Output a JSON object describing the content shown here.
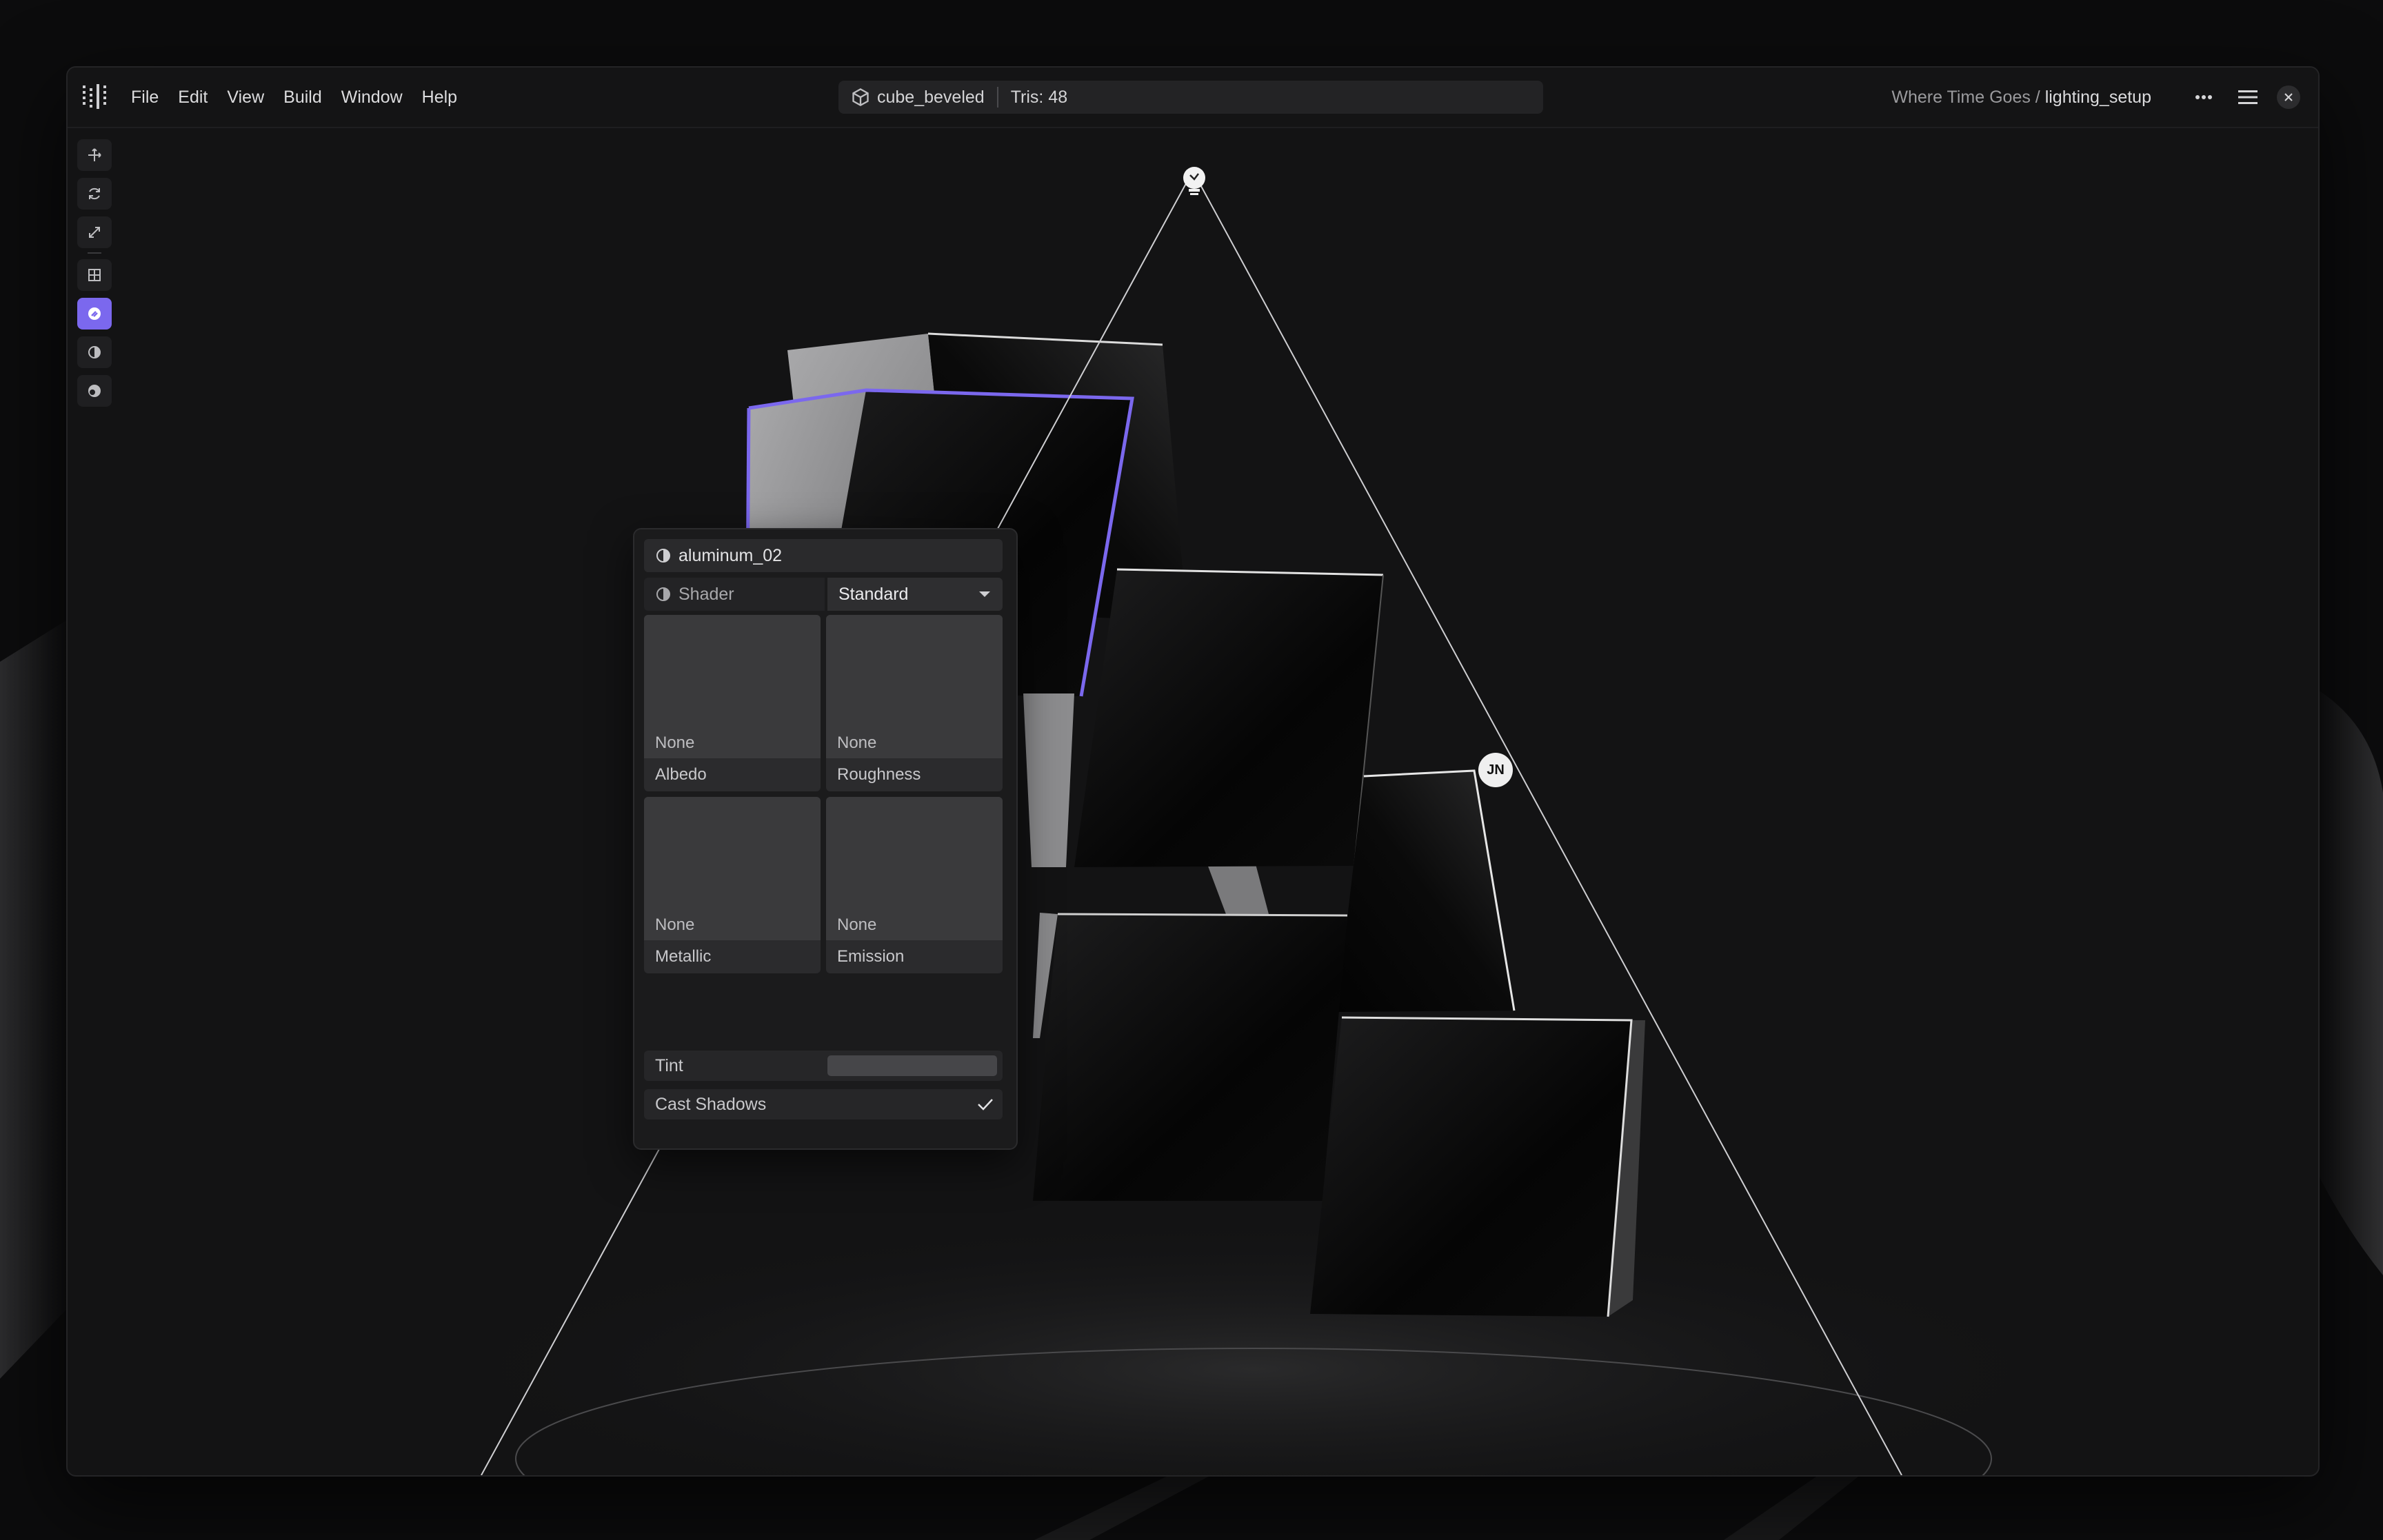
{
  "menu": {
    "items": [
      {
        "label": "File"
      },
      {
        "label": "Edit"
      },
      {
        "label": "View"
      },
      {
        "label": "Build"
      },
      {
        "label": "Window"
      },
      {
        "label": "Help"
      }
    ]
  },
  "object_field": {
    "icon": "cube-icon",
    "name": "cube_beveled",
    "tris": "Tris: 48"
  },
  "breadcrumb": {
    "project": "Where Time Goes / ",
    "scene": "lighting_setup"
  },
  "toolbar": {
    "tools": [
      "move-icon",
      "rotate-icon",
      "scale-icon",
      "grid-icon",
      "paint-icon",
      "material-icon",
      "shading-icon"
    ],
    "active_tool": "paint-icon"
  },
  "material_panel": {
    "material_name": "aluminum_02",
    "shader_label": "Shader",
    "shader_value": "Standard",
    "textures": [
      {
        "slot": "Albedo",
        "value": "None"
      },
      {
        "slot": "Roughness",
        "value": "None"
      },
      {
        "slot": "Metallic",
        "value": "None"
      },
      {
        "slot": "Emission",
        "value": "None"
      }
    ],
    "tint_label": "Tint",
    "tint_color": "#464649",
    "cast_shadows_label": "Cast Shadows",
    "cast_shadows_checked": true
  },
  "viewport": {
    "user_badge": "JN",
    "selection_color": "#7b68ee"
  },
  "colors": {
    "accent": "#7b68ee",
    "window_bg": "#131314",
    "panel_bg": "#1b1b1c"
  }
}
